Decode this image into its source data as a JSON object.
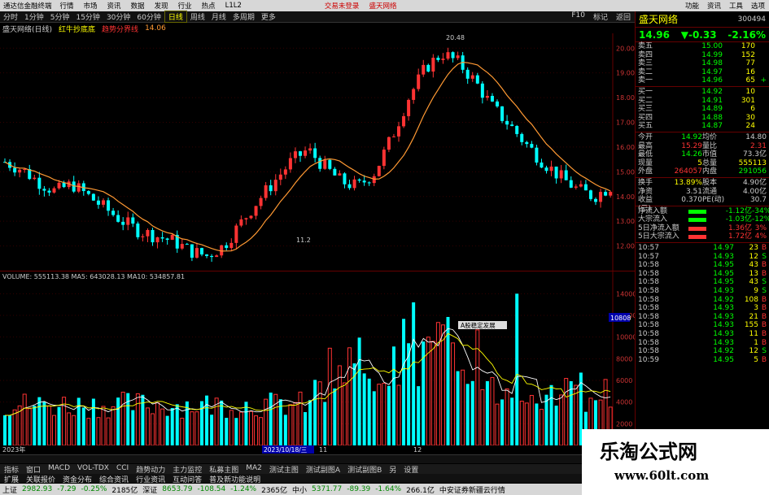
{
  "menubar": {
    "app_title": "通达信金融终端",
    "items": [
      "行情",
      "市场",
      "资讯",
      "数据",
      "",
      "",
      "发现",
      "",
      "行业",
      "热点",
      "L1L2"
    ],
    "trade_login": "交易未登录",
    "brand": "盛天网络",
    "right_items": [
      "功能",
      "资讯",
      "工具",
      "选项"
    ]
  },
  "toolbar": {
    "periods": [
      "分时",
      "1分钟",
      "5分钟",
      "15分钟",
      "30分钟",
      "60分钟",
      "日线",
      "周线",
      "月线",
      "多周期",
      "更多"
    ],
    "active_period": "日线",
    "tools": [
      "F10",
      "",
      "",
      "标记",
      "",
      "返回"
    ]
  },
  "infobar": {
    "stock_label": "盛天网络(日线)",
    "indicator1": "红牛抄底底",
    "indicator2": "趋势分界线",
    "value": "14.06"
  },
  "kline": {
    "price_labels": [
      "20.00",
      "19.00",
      "18.00",
      "17.00",
      "16.00",
      "15.00",
      "14.00",
      "13.00",
      "12.00"
    ],
    "high_label": "20.48",
    "low_label": "11.2",
    "last_label": "14.96",
    "colors": {
      "up": "#ff3333",
      "down": "#00ffff",
      "ma": "#ff9933"
    }
  },
  "volume": {
    "header": "VOLUME: 555113.38  MA5: 643028.13  MA10: 534857.81",
    "axis_labels": [
      "14000",
      "12000",
      "10000",
      "8000",
      "6000",
      "4000",
      "2000"
    ],
    "marker": "10808",
    "tooltip": "A股稳定发展",
    "date_label": "2023年",
    "date_label2": "2023/10/18/三",
    "date_label3": "11",
    "date_label4": "12"
  },
  "right": {
    "name": "盛天网络",
    "code": "300494",
    "price": "14.96",
    "change": "▼-0.33",
    "pct": "-2.16%",
    "sells": [
      {
        "l": "卖五",
        "p": "15.00",
        "v": "170",
        "f": ""
      },
      {
        "l": "卖四",
        "p": "14.99",
        "v": "152",
        "f": ""
      },
      {
        "l": "卖三",
        "p": "14.98",
        "v": "77",
        "f": ""
      },
      {
        "l": "卖二",
        "p": "14.97",
        "v": "16",
        "f": ""
      },
      {
        "l": "卖一",
        "p": "14.96",
        "v": "65",
        "f": "+"
      }
    ],
    "buys": [
      {
        "l": "买一",
        "p": "14.92",
        "v": "10",
        "f": ""
      },
      {
        "l": "买二",
        "p": "14.91",
        "v": "301",
        "f": ""
      },
      {
        "l": "买三",
        "p": "14.89",
        "v": "6",
        "f": ""
      },
      {
        "l": "买四",
        "p": "14.88",
        "v": "30",
        "f": ""
      },
      {
        "l": "买五",
        "p": "14.87",
        "v": "24",
        "f": ""
      }
    ],
    "stats": [
      {
        "l1": "今开",
        "v1": "14.92",
        "c1": "#0f0",
        "l2": "均价",
        "v2": "14.80",
        "c2": "#ccc"
      },
      {
        "l1": "最高",
        "v1": "15.29",
        "c1": "#f33",
        "l2": "量比",
        "v2": "2.31",
        "c2": "#f33"
      },
      {
        "l1": "最低",
        "v1": "14.26",
        "c1": "#0f0",
        "l2": "市值",
        "v2": "73.3亿",
        "c2": "#ccc"
      },
      {
        "l1": "现量",
        "v1": "5",
        "c1": "#ff0",
        "l2": "总量",
        "v2": "555113",
        "c2": "#ff0"
      },
      {
        "l1": "外盘",
        "v1": "264057",
        "c1": "#f33",
        "l2": "内盘",
        "v2": "291056",
        "c2": "#0f0"
      }
    ],
    "stats2": [
      {
        "l1": "换手",
        "v1": "13.89%",
        "c1": "#ff0",
        "l2": "股本",
        "v2": "4.90亿",
        "c2": "#ccc"
      },
      {
        "l1": "净资",
        "v1": "3.51",
        "c1": "#ccc",
        "l2": "流通",
        "v2": "4.00亿",
        "c2": "#ccc"
      },
      {
        "l1": "收益(三)",
        "v1": "0.370",
        "c1": "#ccc",
        "l2": "PE(动)",
        "v2": "30.7",
        "c2": "#ccc"
      }
    ],
    "flows": [
      {
        "l": "净流入额",
        "v": "-1.12亿",
        "p": "-34%",
        "c": "#0f0"
      },
      {
        "l": "大宗流入",
        "v": "-1.03亿",
        "p": "-12%",
        "c": "#0f0"
      },
      {
        "l": "5日净流入额",
        "v": "1.36亿",
        "p": "3%",
        "c": "#f33"
      },
      {
        "l": "5日大宗流入",
        "v": "1.72亿",
        "p": "4%",
        "c": "#f33"
      }
    ],
    "ticks": [
      {
        "t": "10:57",
        "p": "14.97",
        "v": "23",
        "s": "B"
      },
      {
        "t": "10:57",
        "p": "14.93",
        "v": "12",
        "s": "S"
      },
      {
        "t": "10:58",
        "p": "14.95",
        "v": "43",
        "s": "B"
      },
      {
        "t": "10:58",
        "p": "14.95",
        "v": "13",
        "s": "B"
      },
      {
        "t": "10:58",
        "p": "14.95",
        "v": "43",
        "s": "S"
      },
      {
        "t": "10:58",
        "p": "14.93",
        "v": "9",
        "s": "S"
      },
      {
        "t": "10:58",
        "p": "14.92",
        "v": "108",
        "s": "B"
      },
      {
        "t": "10:58",
        "p": "14.93",
        "v": "3",
        "s": "B"
      },
      {
        "t": "10:58",
        "p": "14.93",
        "v": "21",
        "s": "B"
      },
      {
        "t": "10:58",
        "p": "14.93",
        "v": "155",
        "s": "B"
      },
      {
        "t": "10:58",
        "p": "14.93",
        "v": "11",
        "s": "B"
      },
      {
        "t": "10:58",
        "p": "14.93",
        "v": "1",
        "s": "B"
      },
      {
        "t": "10:58",
        "p": "14.92",
        "v": "12",
        "s": "S"
      },
      {
        "t": "10:59",
        "p": "14.95",
        "v": "5",
        "s": "B"
      }
    ]
  },
  "tabs": [
    "指标",
    "窗口",
    "MACD",
    "VOL-TDX",
    "CCI",
    "趋势动力",
    "主力监控",
    "私募主图",
    "MA2",
    "测试主图",
    "测试副图A",
    "测试副图B",
    "另",
    "设置"
  ],
  "tabs2": [
    "扩展",
    "关联报价",
    "资金分布",
    "综合资讯",
    "行业资讯",
    "互动问答",
    "普及新功能说明"
  ],
  "status": {
    "sh_label": "上证",
    "sh_value": "2982.93",
    "sh_chg": "-7.29",
    "sh_pct": "-0.25%",
    "sh_amt": "2185亿",
    "sz_label": "深证",
    "sz_value": "8653.79",
    "sz_chg": "-108.54",
    "sz_pct": "-1.24%",
    "sz_amt": "2365亿",
    "zx_label": "中小",
    "zx_value": "5371.77",
    "zx_chg": "-89.39",
    "zx_pct": "-1.64%",
    "zx_amt": "266.1亿",
    "broker": "中安证券新疆云行情"
  },
  "watermark": {
    "line1": "乐淘公式网",
    "line2": "www.60lt.com"
  }
}
